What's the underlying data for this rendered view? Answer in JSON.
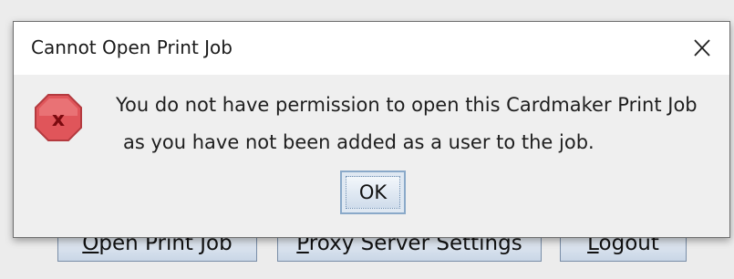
{
  "dialog": {
    "title": "Cannot Open Print Job",
    "message_line1": "You do not have permission to open this Cardmaker Print Job",
    "message_line2": "as you have not been added as a user to the job.",
    "ok_label": "OK",
    "icon": "error-icon",
    "close_icon": "close-icon"
  },
  "background": {
    "open_print_job": {
      "mnemonic": "O",
      "rest": "pen Print Job"
    },
    "proxy_server_settings": {
      "mnemonic": "P",
      "rest": "roxy Server Settings"
    },
    "logout": {
      "mnemonic": "L",
      "rest": "ogout"
    }
  },
  "colors": {
    "error_icon_fill": "#e0555a",
    "error_icon_border": "#b43a3f",
    "error_x": "#7a0a0f"
  }
}
